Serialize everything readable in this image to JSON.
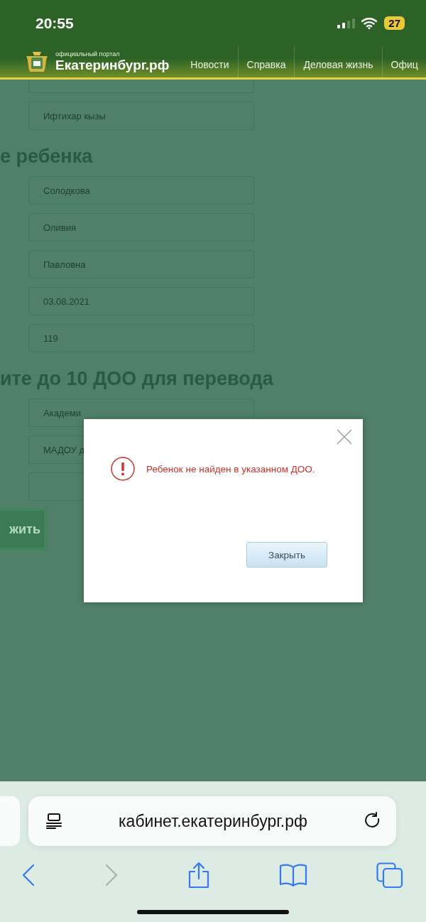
{
  "status_bar": {
    "time": "20:55",
    "battery": "27"
  },
  "header": {
    "portal_caption": "официальный портал",
    "portal_name": "Екатеринбург.рф",
    "nav": [
      {
        "label": "Новости"
      },
      {
        "label": "Справка"
      },
      {
        "label": "Деловая жизнь"
      },
      {
        "label": "Офиц"
      }
    ]
  },
  "form": [
    {
      "kind": "field",
      "partial": true
    },
    {
      "kind": "field",
      "value": "Ифтихар кызы"
    },
    {
      "kind": "heading",
      "text": "е ребенка"
    },
    {
      "kind": "field",
      "value": "Солодкова"
    },
    {
      "kind": "field",
      "value": "Оливия"
    },
    {
      "kind": "field",
      "value": "Павловна"
    },
    {
      "kind": "field",
      "value": "03.08.2021"
    },
    {
      "kind": "field",
      "value": "119"
    },
    {
      "kind": "heading",
      "text": "ите до 10 ДОО для перевода"
    },
    {
      "kind": "field",
      "value": "Академи"
    },
    {
      "kind": "field",
      "value": "МАДОУ д"
    },
    {
      "kind": "field"
    },
    {
      "kind": "button",
      "label": "жить"
    }
  ],
  "dialog": {
    "message": "Ребенок не найден в указанном ДОО.",
    "button": "Закрыть"
  },
  "browser": {
    "url": "кабинет.екатеринбург.рф"
  }
}
